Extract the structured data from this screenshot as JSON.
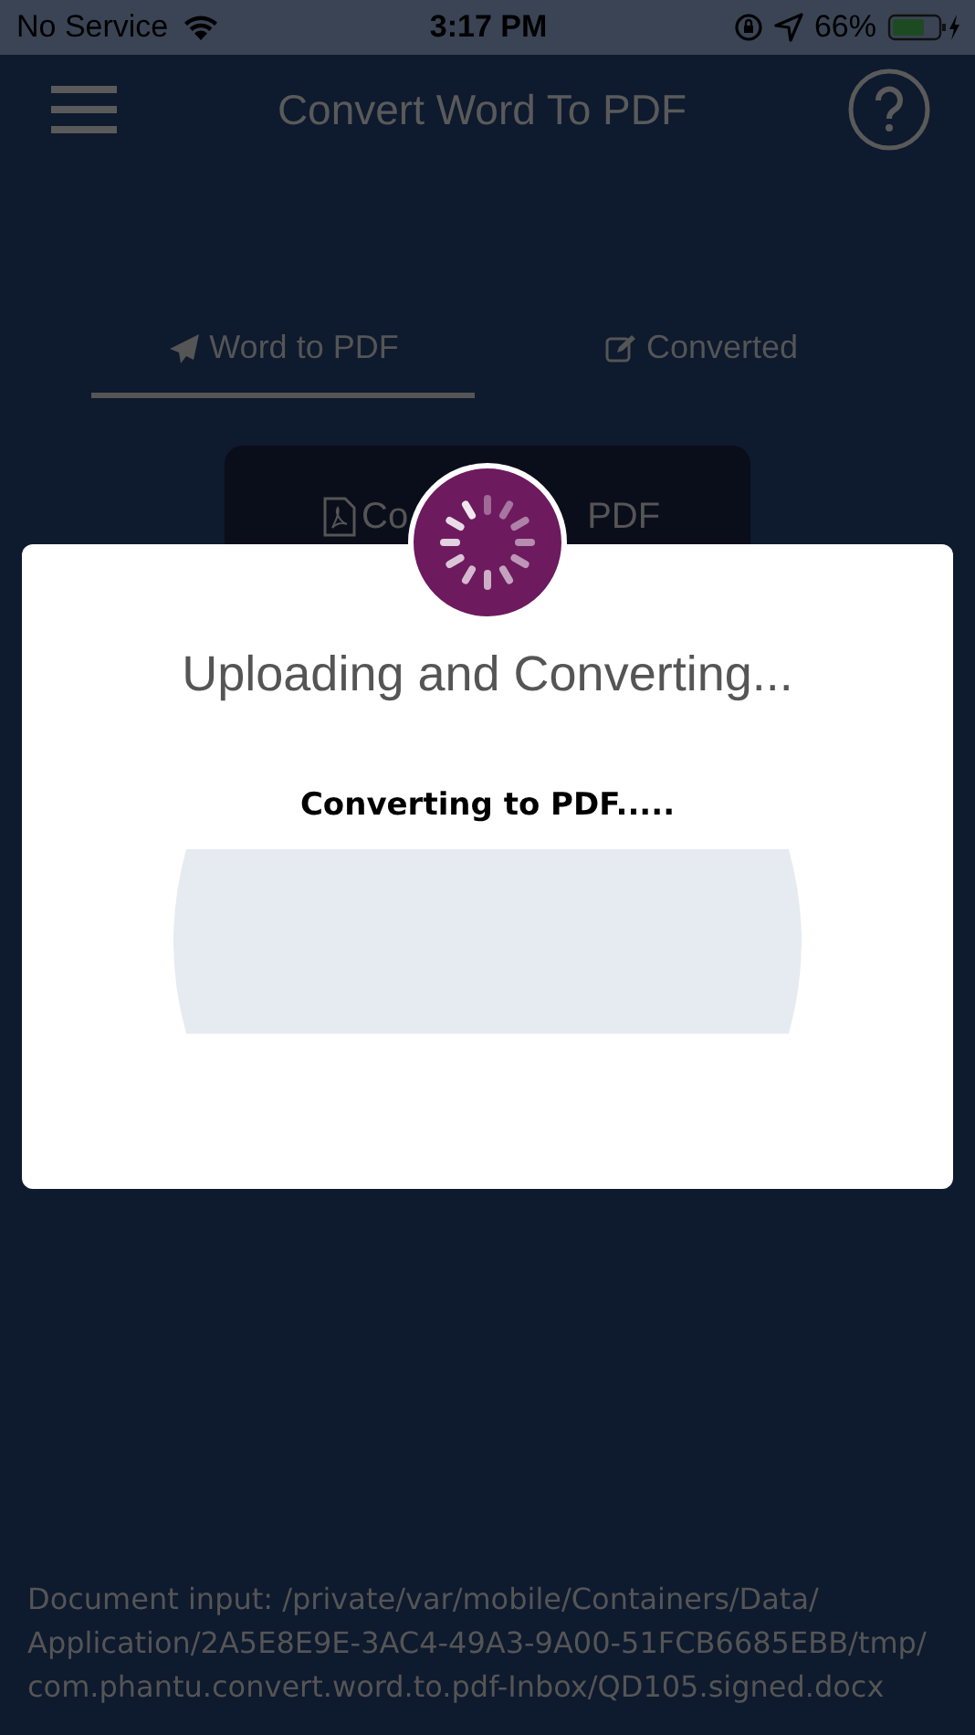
{
  "status_bar": {
    "carrier": "No Service",
    "time": "3:17 PM",
    "battery": "66%"
  },
  "header": {
    "title": "Convert Word To PDF"
  },
  "tabs": [
    {
      "label": "Word to PDF",
      "selected": true
    },
    {
      "label": "Converted",
      "selected": false
    }
  ],
  "convert_button": {
    "label_start": "Co",
    "label_end": "PDF"
  },
  "dialog": {
    "title": "Uploading and Converting...",
    "message": "Converting to PDF....."
  },
  "footer": {
    "text": "Document input: /private/var/mobile/Containers/Data/Application/2A5E8E9E-3AC4-49A3-9A00-51FCB6685EBB/tmp/com.phantu.convert.word.to.pdf-Inbox/QD105.signed.docx"
  }
}
